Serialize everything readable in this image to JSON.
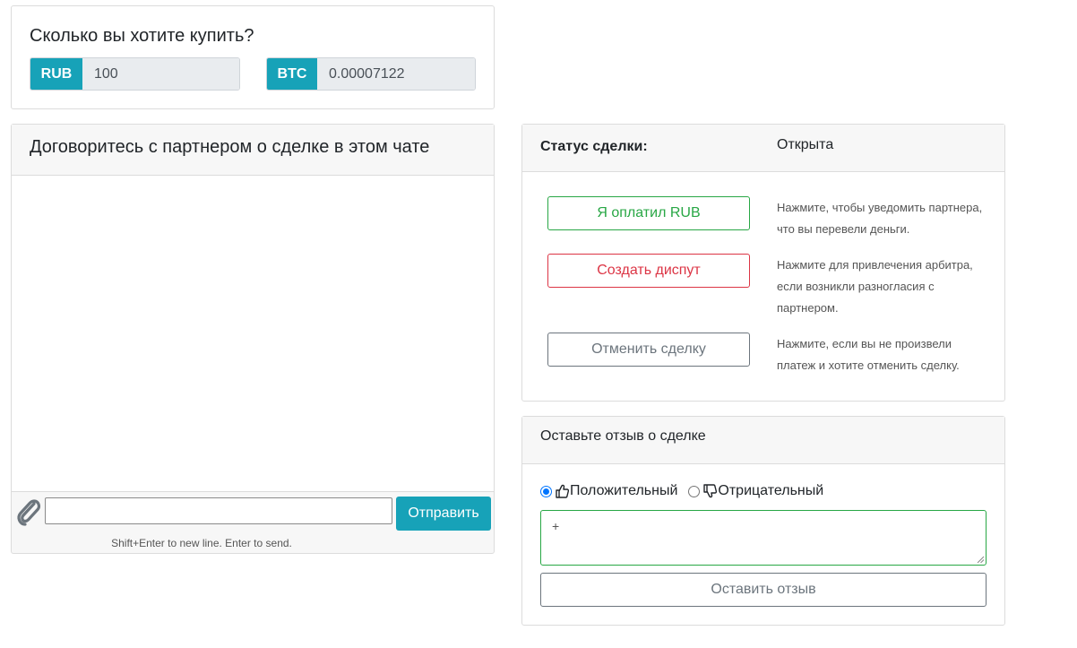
{
  "amount": {
    "title": "Сколько вы хотите купить?",
    "fiat_currency": "RUB",
    "fiat_value": "100",
    "crypto_currency": "BTC",
    "crypto_value": "0.00007122"
  },
  "chat": {
    "title": "Договоритесь с партнером о сделке в этом чате",
    "send_label": "Отправить",
    "hint": "Shift+Enter to new line. Enter to send."
  },
  "status": {
    "label": "Статус сделки:",
    "value": "Открыта",
    "paid_label": "Я оплатил RUB",
    "paid_hint": "Нажмите, чтобы уведомить партнера, что вы перевели деньги.",
    "dispute_label": "Создать диспут",
    "dispute_hint": "Нажмите для привлечения арбитра, если возникли разногласия с партнером.",
    "cancel_label": "Отменить сделку",
    "cancel_hint": "Нажмите, если вы не произвели платеж и хотите отменить сделку."
  },
  "review": {
    "title": "Оставьте отзыв о сделке",
    "positive_label": "Положительный",
    "negative_label": "Отрицательный",
    "selected": "positive",
    "text_value": "+",
    "submit_label": "Оставить отзыв"
  },
  "colors": {
    "info": "#17a2b8",
    "success": "#28a745",
    "danger": "#dc3545",
    "secondary": "#6c757d"
  }
}
